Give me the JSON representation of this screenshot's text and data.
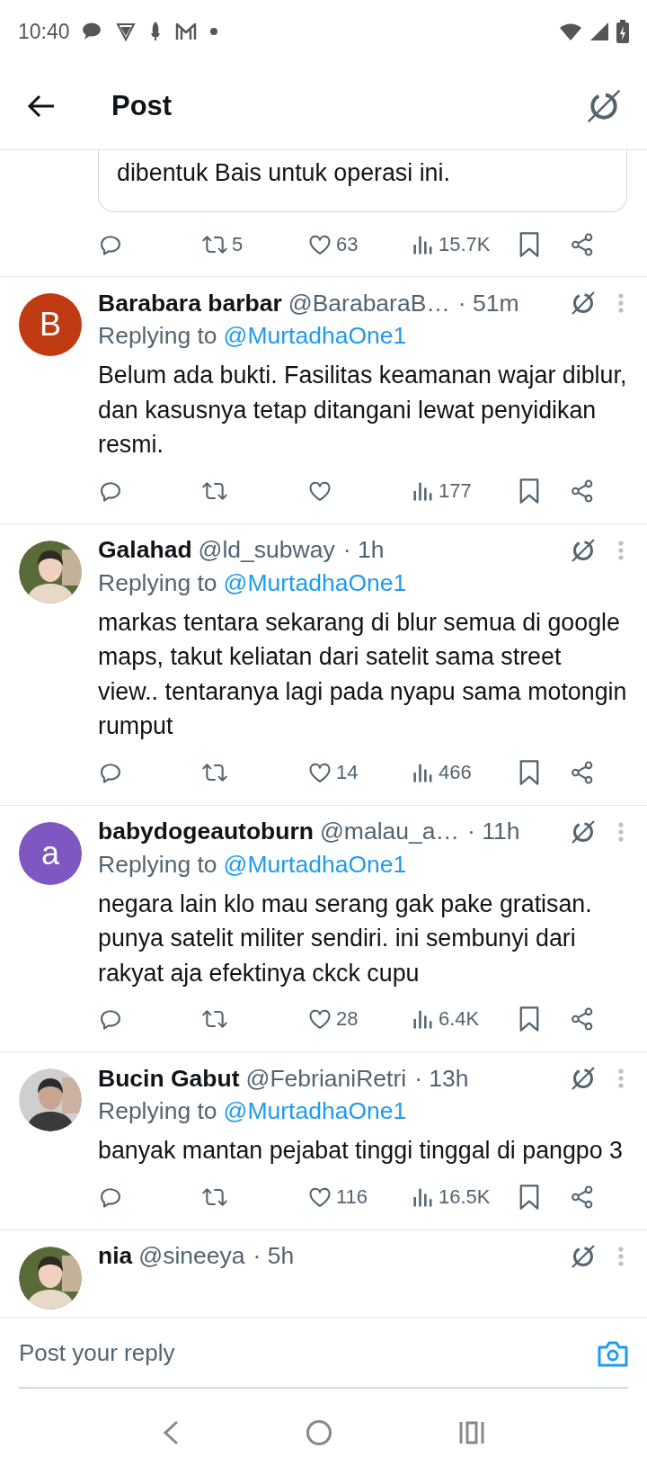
{
  "status_bar": {
    "time": "10:40"
  },
  "header": {
    "title": "Post"
  },
  "quoted_post": {
    "text": "dibentuk Bais untuk operasi ini.",
    "stats": {
      "retweets": "5",
      "likes": "63",
      "views": "15.7K"
    }
  },
  "replies": [
    {
      "name": "Barabara barbar",
      "handle": "@BarabaraB…",
      "time": "· 51m",
      "avatar": {
        "kind": "letter",
        "letter": "B",
        "color": "#c13b12"
      },
      "replying_label": "Replying to",
      "replying_to": "@MurtadhaOne1",
      "body": "Belum ada bukti. Fasilitas keamanan wajar diblur, dan kasusnya tetap ditangani lewat penyidikan resmi.",
      "stats": {
        "views": "177"
      }
    },
    {
      "name": "Galahad",
      "handle": "@ld_subway",
      "time": "· 1h",
      "replying_label": "Replying to",
      "replying_to": "@MurtadhaOne1",
      "body": "markas tentara sekarang di blur semua di google maps, takut keliatan dari satelit sama street view.. tentaranya lagi pada nyapu sama motongin rumput",
      "stats": {
        "likes": "14",
        "views": "466"
      }
    },
    {
      "name": "babydogeautoburn",
      "handle": "@malau_a…",
      "time": "· 11h",
      "avatar": {
        "kind": "letter",
        "letter": "a",
        "color": "#7e57c2"
      },
      "replying_label": "Replying to",
      "replying_to": "@MurtadhaOne1",
      "body": "negara lain klo mau serang gak pake gratisan. punya satelit militer sendiri. ini sembunyi dari rakyat aja efektinya ckck cupu",
      "stats": {
        "likes": "28",
        "views": "6.4K"
      }
    },
    {
      "name": "Bucin Gabut",
      "handle": "@FebrianiRetri",
      "time": "· 13h",
      "replying_label": "Replying to",
      "replying_to": "@MurtadhaOne1",
      "body": "banyak mantan pejabat tinggi tinggal di pangpo 3",
      "stats": {
        "likes": "116",
        "views": "16.5K"
      }
    },
    {
      "name": "nia",
      "handle": "@sineeya",
      "time": "· 5h"
    }
  ],
  "reply_bar": {
    "placeholder": "Post your reply"
  }
}
